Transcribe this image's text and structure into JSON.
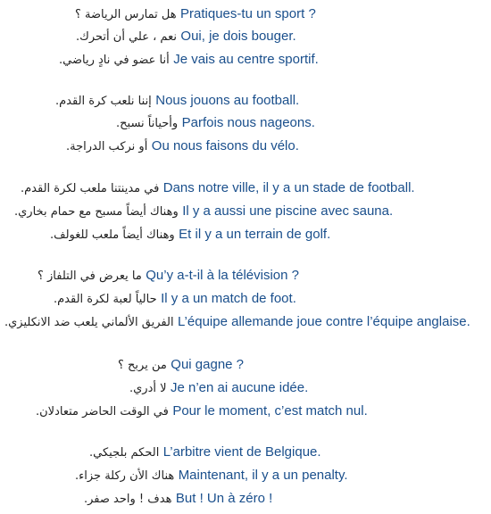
{
  "blocks": [
    {
      "lines": [
        {
          "ar": "هل تمارس الرياضة ؟",
          "fr": "Pratiques-tu un sport ?"
        },
        {
          "ar": "نعم ، علي أن أتحرك.",
          "fr": "Oui, je dois bouger."
        },
        {
          "ar": "أنا عضو في نادٍ رياضي.",
          "fr": "Je vais au centre sportif."
        }
      ]
    },
    {
      "lines": [
        {
          "ar": "إننا نلعب كرة القدم.",
          "fr": "Nous jouons au football."
        },
        {
          "ar": "وأحياناً نسبح.",
          "fr": "Parfois nous nageons."
        },
        {
          "ar": "أو نركب الدراجة.",
          "fr": "Ou nous faisons du vélo."
        }
      ]
    },
    {
      "lines": [
        {
          "ar": "في مدينتنا ملعب لكرة القدم.",
          "fr": "Dans notre ville, il y a un stade de football."
        },
        {
          "ar": "وهناك أيضاً مسبح مع حمام بخاري.",
          "fr": "Il y a aussi une piscine avec sauna."
        },
        {
          "ar": "وهناك أيضاً ملعب للغولف.",
          "fr": "Et il y a un terrain de golf."
        }
      ]
    },
    {
      "lines": [
        {
          "ar": "ما يعرض في التلفاز ؟",
          "fr": "Qu’y a-t-il à la télévision ?"
        },
        {
          "ar": "حالياً لعبة لكرة القدم.",
          "fr": "Il y a un match de foot."
        },
        {
          "ar": "الفريق الألماني يلعب ضد الانكليزي.",
          "fr": "L’équipe allemande joue contre l’équipe anglaise."
        }
      ]
    },
    {
      "lines": [
        {
          "ar": "من يربح ؟",
          "fr": "Qui gagne ?"
        },
        {
          "ar": "لا أدري.",
          "fr": "Je n’en ai aucune idée."
        },
        {
          "ar": "في الوقت الحاضر متعادلان.",
          "fr": "Pour le moment, c’est match nul."
        }
      ]
    },
    {
      "lines": [
        {
          "ar": "الحكم بلجيكي.",
          "fr": "L’arbitre vient de Belgique."
        },
        {
          "ar": "هناك الأن ركلة جزاء.",
          "fr": "Maintenant, il y a un penalty."
        },
        {
          "ar": "هدف ! واحد صفر.",
          "fr": "But ! Un à zéro !"
        }
      ]
    }
  ]
}
